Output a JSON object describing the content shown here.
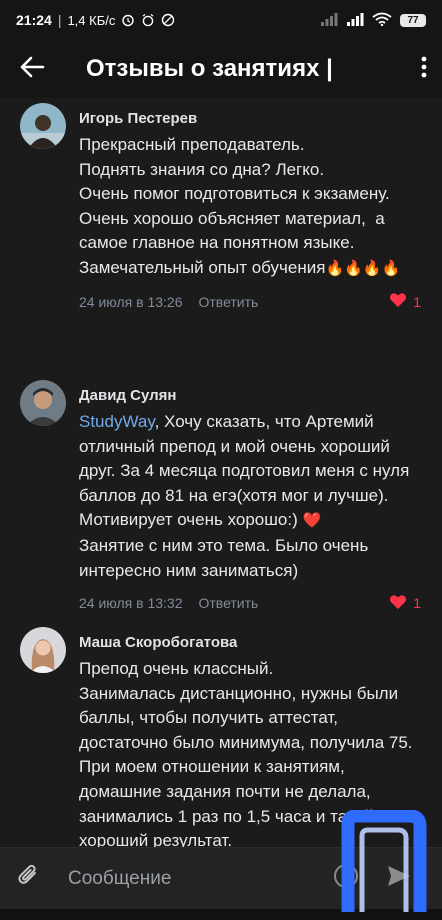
{
  "status_bar": {
    "time": "21:24",
    "separator": "|",
    "speed": "1,4 КБ/с",
    "battery": "77"
  },
  "header": {
    "title": "Отзывы о занятиях | ",
    "back_icon": "arrow-left-icon",
    "menu_icon": "more-vertical-icon"
  },
  "comments": [
    {
      "author": "Игорь Пестерев",
      "text": "Прекрасный преподаватель.\nПоднять знания со дна? Легко.\nОчень помог подготовиться к экзамену. Очень хорошо объясняет материал,  а самое главное на понятном языке.\nЗамечательный опыт обучения",
      "emoji_tail": "🔥🔥🔥🔥",
      "date": "24 июля в 13:26",
      "reply": "Ответить",
      "likes": "1"
    },
    {
      "author": "Давид Сулян",
      "mention": "StudyWay",
      "text": ", Хочу сказать, что Артемий отличный препод и мой очень хороший друг. За 4 месяца подготовил меня с нуля баллов до 81 на егэ(хотя мог и лучше). Мотивирует очень хорошо:)",
      "heart": "❤️",
      "text2": "\nЗанятие с ним это тема. Было очень интересно ним заниматься)",
      "date": "24 июля в 13:32",
      "reply": "Ответить",
      "likes": "1"
    },
    {
      "author": "Маша Скоробогатова",
      "text": "Препод очень классный.\nЗанималась дистанционно, нужны были баллы, чтобы получить аттестат, достаточно было минимума, получила 75. При моем отношении к занятиям, домашние задания почти не делала, занимались 1 раз по 1,5 часа и такой хороший результат."
    }
  ],
  "composer": {
    "placeholder": "Сообщение"
  },
  "colors": {
    "background": "#1b1b1b",
    "link": "#71aaeb",
    "like": "#ff3347",
    "logo": "#2f6bff"
  }
}
